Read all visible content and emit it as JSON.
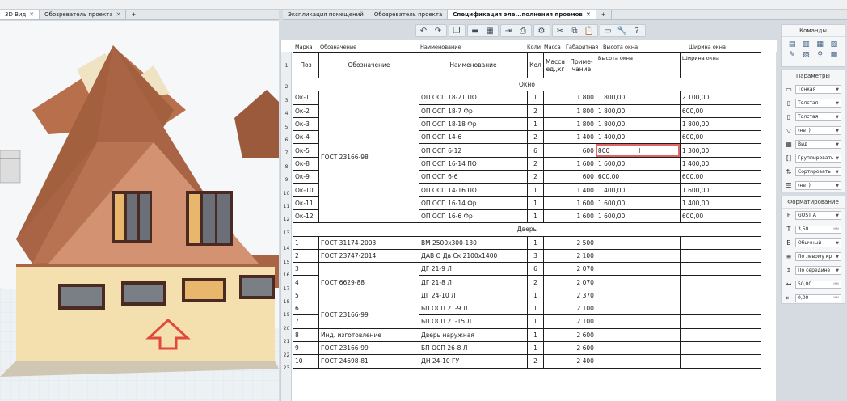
{
  "left_tabs": [
    {
      "label": "3D Вид",
      "active": true
    },
    {
      "label": "Обозреватель проекта",
      "active": false
    }
  ],
  "right_tabs": [
    {
      "label": "Экспликация помещений",
      "active": false
    },
    {
      "label": "Обозреватель проекта",
      "active": false
    },
    {
      "label": "Спецификация эле...полнения проемов",
      "active": true
    }
  ],
  "sheet_header": [
    "Марка",
    "Обозначение",
    "Наименование",
    "Коли",
    "Масса",
    "Габаритная",
    "Высота окна",
    "Ширина окна"
  ],
  "row_numbers": [
    "1",
    "2",
    "3",
    "4",
    "5",
    "6",
    "7",
    "8",
    "9",
    "10",
    "11",
    "12",
    "13",
    "14",
    "15",
    "16",
    "17",
    "18",
    "19",
    "20",
    "21",
    "22",
    "23"
  ],
  "table": {
    "head": {
      "poz": "Поз",
      "oboz": "Обозначение",
      "naim": "Наименование",
      "kol": "Кол",
      "massa": "Масса ед.,кг",
      "prim": "Приме-чание",
      "h": "Высота окна",
      "w": "Ширина окна"
    },
    "section_windows": "Окно",
    "section_doors": "Дверь",
    "windows_gost": "ГОСТ 23166-98",
    "windows": [
      {
        "poz": "Ок-1",
        "naim": "ОП ОСП 18-21 ПО",
        "kol": "1",
        "prim": "1 800",
        "h": "1 800,00",
        "w": "2 100,00"
      },
      {
        "poz": "Ок-2",
        "naim": "ОП ОСП 18-7 Фр",
        "kol": "2",
        "prim": "1 800",
        "h": "1 800,00",
        "w": "600,00"
      },
      {
        "poz": "Ок-3",
        "naim": "ОП ОСП 18-18 Фр",
        "kol": "1",
        "prim": "1 800",
        "h": "1 800,00",
        "w": "1 800,00"
      },
      {
        "poz": "Ок-4",
        "naim": "ОП ОСП 14-6",
        "kol": "2",
        "prim": "1 400",
        "h": "1 400,00",
        "w": "600,00"
      },
      {
        "poz": "Ок-5",
        "naim": "ОП ОСП 6-12",
        "kol": "6",
        "prim": "600",
        "h": "800",
        "w": "1 300,00"
      },
      {
        "poz": "Ок-8",
        "naim": "ОП ОСП 16-14 ПО",
        "kol": "2",
        "prim": "1 600",
        "h": "1 600,00",
        "w": "1 400,00"
      },
      {
        "poz": "Ок-9",
        "naim": "ОП ОСП 6-6",
        "kol": "2",
        "prim": "600",
        "h": "600,00",
        "w": "600,00"
      },
      {
        "poz": "Ок-10",
        "naim": "ОП ОСП 14-16 ПО",
        "kol": "1",
        "prim": "1 400",
        "h": "1 400,00",
        "w": "1 600,00"
      },
      {
        "poz": "Ок-11",
        "naim": "ОП ОСП 16-14 Фр",
        "kol": "1",
        "prim": "1 600",
        "h": "1 600,00",
        "w": "1 400,00"
      },
      {
        "poz": "Ок-12",
        "naim": "ОП ОСП 16-6 Фр",
        "kol": "1",
        "prim": "1 600",
        "h": "1 600,00",
        "w": "600,00"
      }
    ],
    "door_g4": "ГОСТ 6629-88",
    "door_g5": "ГОСТ 23166-99",
    "doors": [
      {
        "poz": "1",
        "oboz": "ГОСТ 31174-2003",
        "naim": "ВМ 2500х300-130",
        "kol": "1",
        "prim": "2 500"
      },
      {
        "poz": "2",
        "oboz": "ГОСТ 23747-2014",
        "naim": "ДАВ О Дв Ск 2100х1400",
        "kol": "3",
        "prim": "2 100"
      },
      {
        "poz": "3",
        "oboz": "",
        "naim": "ДГ 21-9 Л",
        "kol": "6",
        "prim": "2 070"
      },
      {
        "poz": "4",
        "oboz": "",
        "naim": "ДГ 21-8 Л",
        "kol": "2",
        "prim": "2 070"
      },
      {
        "poz": "5",
        "oboz": "",
        "naim": "ДГ 24-10 Л",
        "kol": "1",
        "prim": "2 370"
      },
      {
        "poz": "6",
        "oboz": "",
        "naim": "БП ОСП 21-9 Л",
        "kol": "1",
        "prim": "2 100"
      },
      {
        "poz": "7",
        "oboz": "",
        "naim": "БП ОСП 21-15 Л",
        "kol": "1",
        "prim": "2 100"
      },
      {
        "poz": "8",
        "oboz": "Инд. изготовление",
        "naim": "Дверь наружная",
        "kol": "1",
        "prim": "2 600"
      },
      {
        "poz": "9",
        "oboz": "ГОСТ 23166-99",
        "naim": "БП ОСП 26-8 Л",
        "kol": "1",
        "prim": "2 600"
      },
      {
        "poz": "10",
        "oboz": "ГОСТ 24698-81",
        "naim": "ДН 24-10 ГУ",
        "kol": "2",
        "prim": "2 400"
      }
    ]
  },
  "panels": {
    "commands_title": "Команды",
    "params_title": "Параметры",
    "format_title": "Форматирование",
    "params": [
      {
        "icon": "line-icon",
        "value": "Тонкая"
      },
      {
        "icon": "border-icon",
        "value": "Толстая"
      },
      {
        "icon": "border-icon",
        "value": "Толстая"
      },
      {
        "icon": "filter-icon",
        "value": "(нет)"
      },
      {
        "icon": "table-icon",
        "value": "Вид"
      },
      {
        "icon": "group-icon",
        "value": "Группировать"
      },
      {
        "icon": "sort-icon",
        "value": "Сортировать"
      },
      {
        "icon": "list-icon",
        "value": "(нет)"
      }
    ],
    "format": [
      {
        "icon": "font-icon",
        "value": "GOST A",
        "type": "select"
      },
      {
        "icon": "font-size-icon",
        "value": "3,50",
        "unit": "мм",
        "type": "input"
      },
      {
        "icon": "bold-icon",
        "value": "Обычный",
        "type": "select"
      },
      {
        "icon": "align-icon",
        "value": "По левому кр",
        "type": "select"
      },
      {
        "icon": "valign-icon",
        "value": "По середине",
        "type": "select"
      },
      {
        "icon": "width-icon",
        "value": "50,00",
        "unit": "мм",
        "type": "input"
      },
      {
        "icon": "indent-icon",
        "value": "0,00",
        "unit": "мм",
        "type": "input"
      }
    ]
  }
}
